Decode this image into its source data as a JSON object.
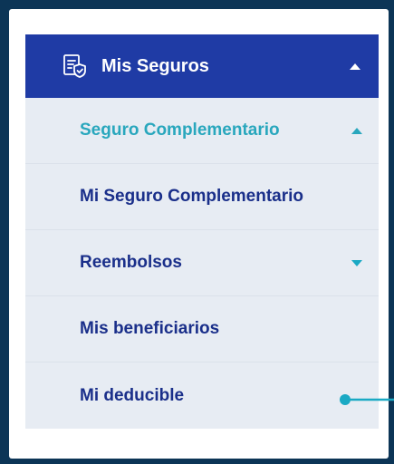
{
  "menu": {
    "header": {
      "label": "Mis Seguros",
      "icon": "insurance-document-shield-icon",
      "expanded": true
    },
    "items": [
      {
        "label": "Seguro Complementario",
        "active": true,
        "expanded": true
      },
      {
        "label": "Mi Seguro Complementario"
      },
      {
        "label": "Reembolsos",
        "expanded": false
      },
      {
        "label": "Mis beneficiarios"
      },
      {
        "label": "Mi deducible"
      }
    ]
  },
  "colors": {
    "background": "#0c3556",
    "header": "#1f3ba5",
    "submenu": "#e7ecf3",
    "item_text": "#1a2f8a",
    "active_text": "#29a7bd",
    "pointer": "#1aa9c4"
  }
}
